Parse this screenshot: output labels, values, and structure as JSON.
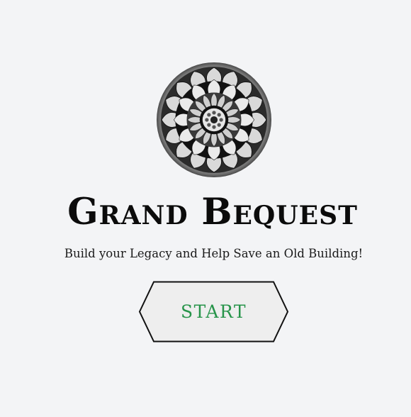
{
  "header": {
    "logo_icon": "ornate-mandala-emblem-icon",
    "title": "Grand Bequest",
    "tagline": "Build your Legacy and Help Save an Old Building!"
  },
  "actions": {
    "start_label": "START"
  },
  "colors": {
    "background": "#f3f4f6",
    "title": "#0b0b0b",
    "start_text": "#27944a",
    "start_fill": "#eeeeee",
    "start_border": "#111111"
  }
}
